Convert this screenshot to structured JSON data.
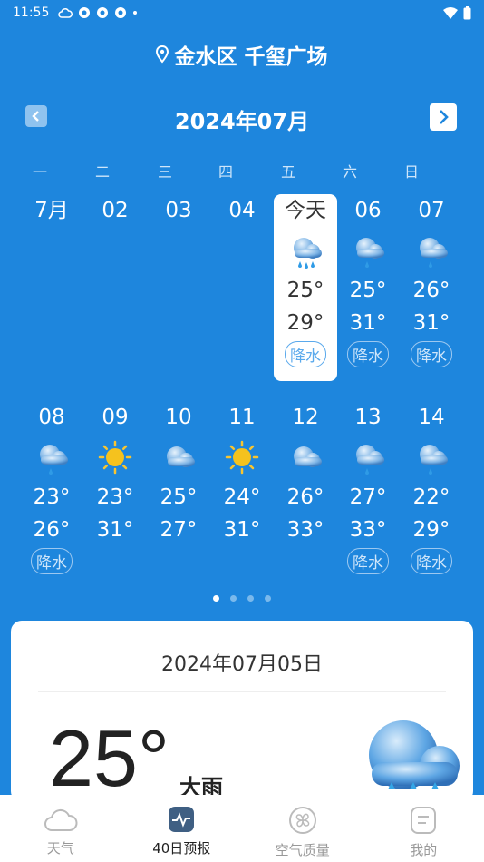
{
  "status_bar": {
    "time": "11:55"
  },
  "location": {
    "name": "金水区 千玺广场"
  },
  "calendar": {
    "month_title": "2024年07月",
    "weekdays": [
      "一",
      "二",
      "三",
      "四",
      "五",
      "六",
      "日"
    ],
    "week1": [
      {
        "date": "7月",
        "icon": "none",
        "low": "",
        "high": "",
        "precip": ""
      },
      {
        "date": "02",
        "icon": "none",
        "low": "",
        "high": "",
        "precip": ""
      },
      {
        "date": "03",
        "icon": "none",
        "low": "",
        "high": "",
        "precip": ""
      },
      {
        "date": "04",
        "icon": "none",
        "low": "",
        "high": "",
        "precip": ""
      },
      {
        "date": "今天",
        "icon": "heavy-rain-icon",
        "low": "25°",
        "high": "29°",
        "precip": "降水",
        "today": true
      },
      {
        "date": "06",
        "icon": "rain-cloud-icon",
        "low": "25°",
        "high": "31°",
        "precip": "降水"
      },
      {
        "date": "07",
        "icon": "rain-cloud-icon",
        "low": "26°",
        "high": "31°",
        "precip": "降水"
      }
    ],
    "week2": [
      {
        "date": "08",
        "icon": "rain-cloud-icon",
        "low": "23°",
        "high": "26°",
        "precip": "降水"
      },
      {
        "date": "09",
        "icon": "sun-icon",
        "low": "23°",
        "high": "31°",
        "precip": ""
      },
      {
        "date": "10",
        "icon": "cloud-icon",
        "low": "25°",
        "high": "27°",
        "precip": ""
      },
      {
        "date": "11",
        "icon": "sun-icon",
        "low": "24°",
        "high": "31°",
        "precip": ""
      },
      {
        "date": "12",
        "icon": "cloud-icon",
        "low": "26°",
        "high": "33°",
        "precip": ""
      },
      {
        "date": "13",
        "icon": "rain-cloud-icon",
        "low": "27°",
        "high": "33°",
        "precip": "降水"
      },
      {
        "date": "14",
        "icon": "rain-cloud-icon",
        "low": "22°",
        "high": "29°",
        "precip": "降水"
      }
    ]
  },
  "pager": {
    "count": 4,
    "active": 0
  },
  "detail": {
    "date": "2024年07月05日",
    "temp": "25°",
    "condition": "大雨",
    "icon": "heavy-rain-icon"
  },
  "tabbar": {
    "tabs": [
      {
        "label": "天气",
        "icon": "cloud-outline-icon"
      },
      {
        "label": "40日预报",
        "icon": "forecast-chart-icon",
        "active": true
      },
      {
        "label": "空气质量",
        "icon": "fan-icon"
      },
      {
        "label": "我的",
        "icon": "profile-card-icon"
      }
    ]
  },
  "colors": {
    "background": "#1e86dd",
    "card": "#ffffff",
    "today_badge": "#5aa9ec"
  }
}
